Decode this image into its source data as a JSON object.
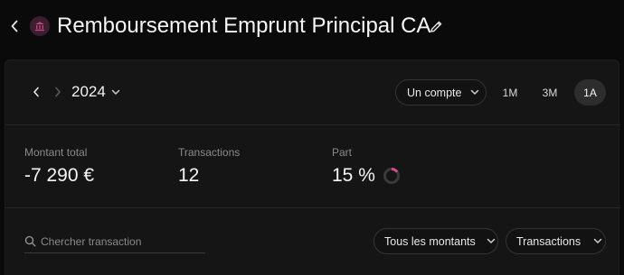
{
  "header": {
    "title": "Remboursement Emprunt Principal CA",
    "category_icon": "bank-icon",
    "category_color": "#c2477f"
  },
  "toolbar": {
    "year": "2024",
    "account_select": "Un compte",
    "periods": [
      "1M",
      "3M",
      "1A"
    ],
    "active_period": "1A"
  },
  "stats": {
    "total_label": "Montant total",
    "total_value": "-7 290 €",
    "tx_label": "Transactions",
    "tx_value": "12",
    "share_label": "Part",
    "share_value": "15 %",
    "share_fraction": 0.15,
    "share_color": "#d94a8c"
  },
  "filters": {
    "search_placeholder": "Chercher transaction",
    "amount_filter": "Tous les montants",
    "type_filter": "Transactions"
  }
}
